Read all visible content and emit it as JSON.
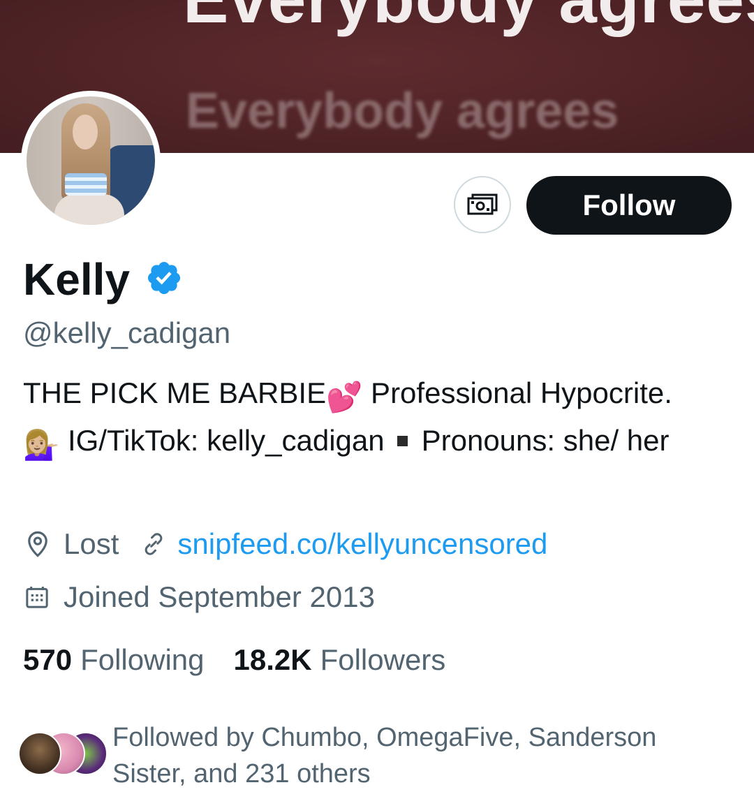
{
  "banner": {
    "headline": "Everybody agrees",
    "subline": "Everybody agrees"
  },
  "actions": {
    "tip_icon": "money-icon",
    "follow_label": "Follow"
  },
  "profile": {
    "display_name": "Kelly",
    "verified_icon": "verified-badge-icon",
    "verified_color": "#1d9bf0",
    "handle": "@kelly_cadigan"
  },
  "bio": {
    "part1": "THE PICK ME BARBIE",
    "heart_emoji": "💕",
    "part2": " Professional Hypocrite.",
    "person_emoji": "💁🏼‍♀️",
    "part3": " IG/TikTok: kelly_cadigan",
    "part4": "Pronouns: she/ her"
  },
  "meta": {
    "location_icon": "location-pin-icon",
    "location": "Lost",
    "link_icon": "link-icon",
    "link": "snipfeed.co/kellyuncensored",
    "calendar_icon": "calendar-icon",
    "joined": "Joined September 2013"
  },
  "stats": {
    "following_count": "570",
    "following_label": "Following",
    "followers_count": "18.2K",
    "followers_label": "Followers"
  },
  "followed_by": {
    "text": "Followed by Chumbo, OmegaFive, Sanderson Sister, and 231 others"
  },
  "colors": {
    "accent": "#1d9bf0",
    "text_primary": "#0f1419",
    "text_secondary": "#536471",
    "banner": "#4f2326"
  }
}
